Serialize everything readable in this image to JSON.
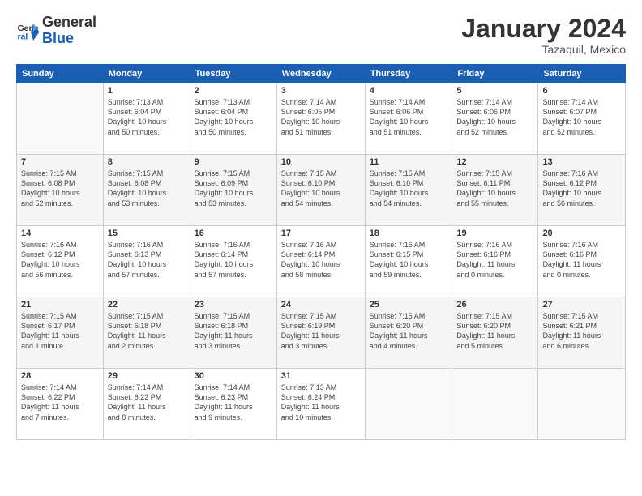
{
  "header": {
    "title": "January 2024",
    "subtitle": "Tazaquil, Mexico"
  },
  "days": [
    "Sunday",
    "Monday",
    "Tuesday",
    "Wednesday",
    "Thursday",
    "Friday",
    "Saturday"
  ],
  "weeks": [
    [
      {
        "num": "",
        "info": ""
      },
      {
        "num": "1",
        "info": "Sunrise: 7:13 AM\nSunset: 6:04 PM\nDaylight: 10 hours\nand 50 minutes."
      },
      {
        "num": "2",
        "info": "Sunrise: 7:13 AM\nSunset: 6:04 PM\nDaylight: 10 hours\nand 50 minutes."
      },
      {
        "num": "3",
        "info": "Sunrise: 7:14 AM\nSunset: 6:05 PM\nDaylight: 10 hours\nand 51 minutes."
      },
      {
        "num": "4",
        "info": "Sunrise: 7:14 AM\nSunset: 6:06 PM\nDaylight: 10 hours\nand 51 minutes."
      },
      {
        "num": "5",
        "info": "Sunrise: 7:14 AM\nSunset: 6:06 PM\nDaylight: 10 hours\nand 52 minutes."
      },
      {
        "num": "6",
        "info": "Sunrise: 7:14 AM\nSunset: 6:07 PM\nDaylight: 10 hours\nand 52 minutes."
      }
    ],
    [
      {
        "num": "7",
        "info": "Sunrise: 7:15 AM\nSunset: 6:08 PM\nDaylight: 10 hours\nand 52 minutes."
      },
      {
        "num": "8",
        "info": "Sunrise: 7:15 AM\nSunset: 6:08 PM\nDaylight: 10 hours\nand 53 minutes."
      },
      {
        "num": "9",
        "info": "Sunrise: 7:15 AM\nSunset: 6:09 PM\nDaylight: 10 hours\nand 53 minutes."
      },
      {
        "num": "10",
        "info": "Sunrise: 7:15 AM\nSunset: 6:10 PM\nDaylight: 10 hours\nand 54 minutes."
      },
      {
        "num": "11",
        "info": "Sunrise: 7:15 AM\nSunset: 6:10 PM\nDaylight: 10 hours\nand 54 minutes."
      },
      {
        "num": "12",
        "info": "Sunrise: 7:15 AM\nSunset: 6:11 PM\nDaylight: 10 hours\nand 55 minutes."
      },
      {
        "num": "13",
        "info": "Sunrise: 7:16 AM\nSunset: 6:12 PM\nDaylight: 10 hours\nand 56 minutes."
      }
    ],
    [
      {
        "num": "14",
        "info": "Sunrise: 7:16 AM\nSunset: 6:12 PM\nDaylight: 10 hours\nand 56 minutes."
      },
      {
        "num": "15",
        "info": "Sunrise: 7:16 AM\nSunset: 6:13 PM\nDaylight: 10 hours\nand 57 minutes."
      },
      {
        "num": "16",
        "info": "Sunrise: 7:16 AM\nSunset: 6:14 PM\nDaylight: 10 hours\nand 57 minutes."
      },
      {
        "num": "17",
        "info": "Sunrise: 7:16 AM\nSunset: 6:14 PM\nDaylight: 10 hours\nand 58 minutes."
      },
      {
        "num": "18",
        "info": "Sunrise: 7:16 AM\nSunset: 6:15 PM\nDaylight: 10 hours\nand 59 minutes."
      },
      {
        "num": "19",
        "info": "Sunrise: 7:16 AM\nSunset: 6:16 PM\nDaylight: 11 hours\nand 0 minutes."
      },
      {
        "num": "20",
        "info": "Sunrise: 7:16 AM\nSunset: 6:16 PM\nDaylight: 11 hours\nand 0 minutes."
      }
    ],
    [
      {
        "num": "21",
        "info": "Sunrise: 7:15 AM\nSunset: 6:17 PM\nDaylight: 11 hours\nand 1 minute."
      },
      {
        "num": "22",
        "info": "Sunrise: 7:15 AM\nSunset: 6:18 PM\nDaylight: 11 hours\nand 2 minutes."
      },
      {
        "num": "23",
        "info": "Sunrise: 7:15 AM\nSunset: 6:18 PM\nDaylight: 11 hours\nand 3 minutes."
      },
      {
        "num": "24",
        "info": "Sunrise: 7:15 AM\nSunset: 6:19 PM\nDaylight: 11 hours\nand 3 minutes."
      },
      {
        "num": "25",
        "info": "Sunrise: 7:15 AM\nSunset: 6:20 PM\nDaylight: 11 hours\nand 4 minutes."
      },
      {
        "num": "26",
        "info": "Sunrise: 7:15 AM\nSunset: 6:20 PM\nDaylight: 11 hours\nand 5 minutes."
      },
      {
        "num": "27",
        "info": "Sunrise: 7:15 AM\nSunset: 6:21 PM\nDaylight: 11 hours\nand 6 minutes."
      }
    ],
    [
      {
        "num": "28",
        "info": "Sunrise: 7:14 AM\nSunset: 6:22 PM\nDaylight: 11 hours\nand 7 minutes."
      },
      {
        "num": "29",
        "info": "Sunrise: 7:14 AM\nSunset: 6:22 PM\nDaylight: 11 hours\nand 8 minutes."
      },
      {
        "num": "30",
        "info": "Sunrise: 7:14 AM\nSunset: 6:23 PM\nDaylight: 11 hours\nand 9 minutes."
      },
      {
        "num": "31",
        "info": "Sunrise: 7:13 AM\nSunset: 6:24 PM\nDaylight: 11 hours\nand 10 minutes."
      },
      {
        "num": "",
        "info": ""
      },
      {
        "num": "",
        "info": ""
      },
      {
        "num": "",
        "info": ""
      }
    ]
  ]
}
